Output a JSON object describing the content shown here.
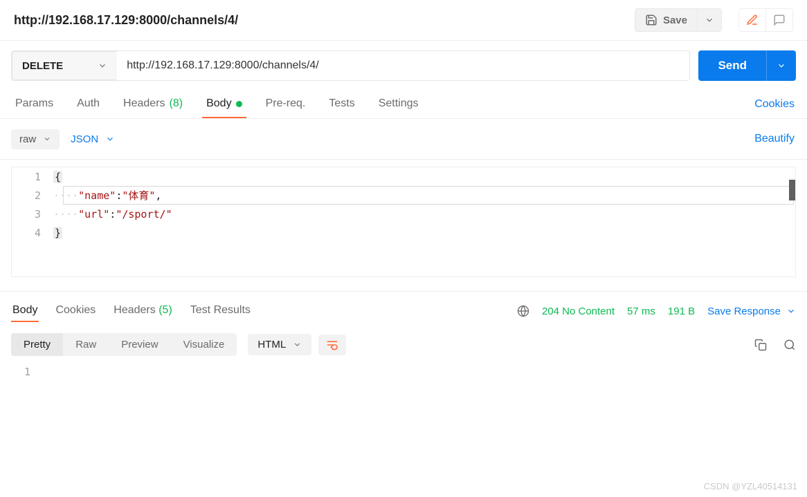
{
  "title": "http://192.168.17.129:8000/channels/4/",
  "save_label": "Save",
  "request": {
    "method": "DELETE",
    "url": "http://192.168.17.129:8000/channels/4/",
    "send_label": "Send"
  },
  "req_tabs": {
    "params": "Params",
    "auth": "Auth",
    "headers_label": "Headers",
    "headers_count": "(8)",
    "body": "Body",
    "prereq": "Pre-req.",
    "tests": "Tests",
    "settings": "Settings",
    "cookies": "Cookies"
  },
  "body_bar": {
    "raw": "raw",
    "json": "JSON",
    "beautify": "Beautify"
  },
  "editor_lines": [
    "1",
    "2",
    "3",
    "4"
  ],
  "body_json": {
    "name": "体育",
    "url": "/sport/"
  },
  "res_tabs": {
    "body": "Body",
    "cookies": "Cookies",
    "headers_label": "Headers",
    "headers_count": "(5)",
    "tests": "Test Results"
  },
  "status": {
    "code": "204 No Content",
    "time": "57 ms",
    "size": "191 B",
    "save_resp": "Save Response"
  },
  "res_sub": {
    "pretty": "Pretty",
    "raw": "Raw",
    "preview": "Preview",
    "viz": "Visualize",
    "format": "HTML"
  },
  "res_body_line": "1",
  "watermark": "CSDN @YZL40514131"
}
